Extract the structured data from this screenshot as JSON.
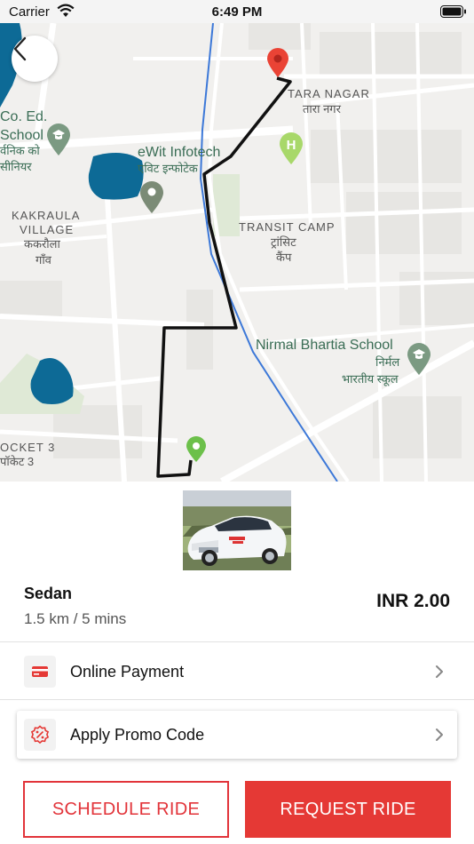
{
  "status_bar": {
    "carrier": "Carrier",
    "time": "6:49 PM"
  },
  "map": {
    "labels": {
      "tara_nagar_en": "TARA NAGAR",
      "tara_nagar_hi": "तारा नगर",
      "co_ed_school_1": "Co. Ed.",
      "co_ed_school_2": "School",
      "co_ed_school_hi_1": "र्वनिक को",
      "co_ed_school_hi_2": "सीनियर",
      "ewit_en": "eWit Infotech",
      "ewit_hi": "एविट इन्फोटेक",
      "kakraula_1": "KAKRAULA",
      "kakraula_2": "VILLAGE",
      "kakraula_hi_1": "ककरौला",
      "kakraula_hi_2": "गाँव",
      "transit_en": "TRANSIT CAMP",
      "transit_hi_1": "ट्रांसिट",
      "transit_hi_2": "कैंप",
      "nirmal_en": "Nirmal Bhartia School",
      "nirmal_hi_1": "निर्मल",
      "nirmal_hi_2": "भारतीय स्कूल",
      "pocket_en": "OCKET 3",
      "pocket_hi": "पॉकेट 3"
    },
    "colors": {
      "route": "#111111",
      "water": "#0d6a96",
      "park": "#dfe9d6",
      "rail": "#3c78d8",
      "destination_pin": "#ea4335",
      "origin_pin": "#6cc04a",
      "poi_pin": "#7b8b76"
    }
  },
  "vehicle": {
    "name": "Sedan",
    "eta": "1.5 km / 5 mins",
    "price": "INR 2.00"
  },
  "payment": {
    "label": "Online Payment",
    "icon": "card-icon"
  },
  "promo": {
    "label": "Apply Promo Code",
    "icon": "discount-icon"
  },
  "actions": {
    "schedule": "SCHEDULE RIDE",
    "request": "REQUEST RIDE"
  },
  "accent_color": "#e53935"
}
